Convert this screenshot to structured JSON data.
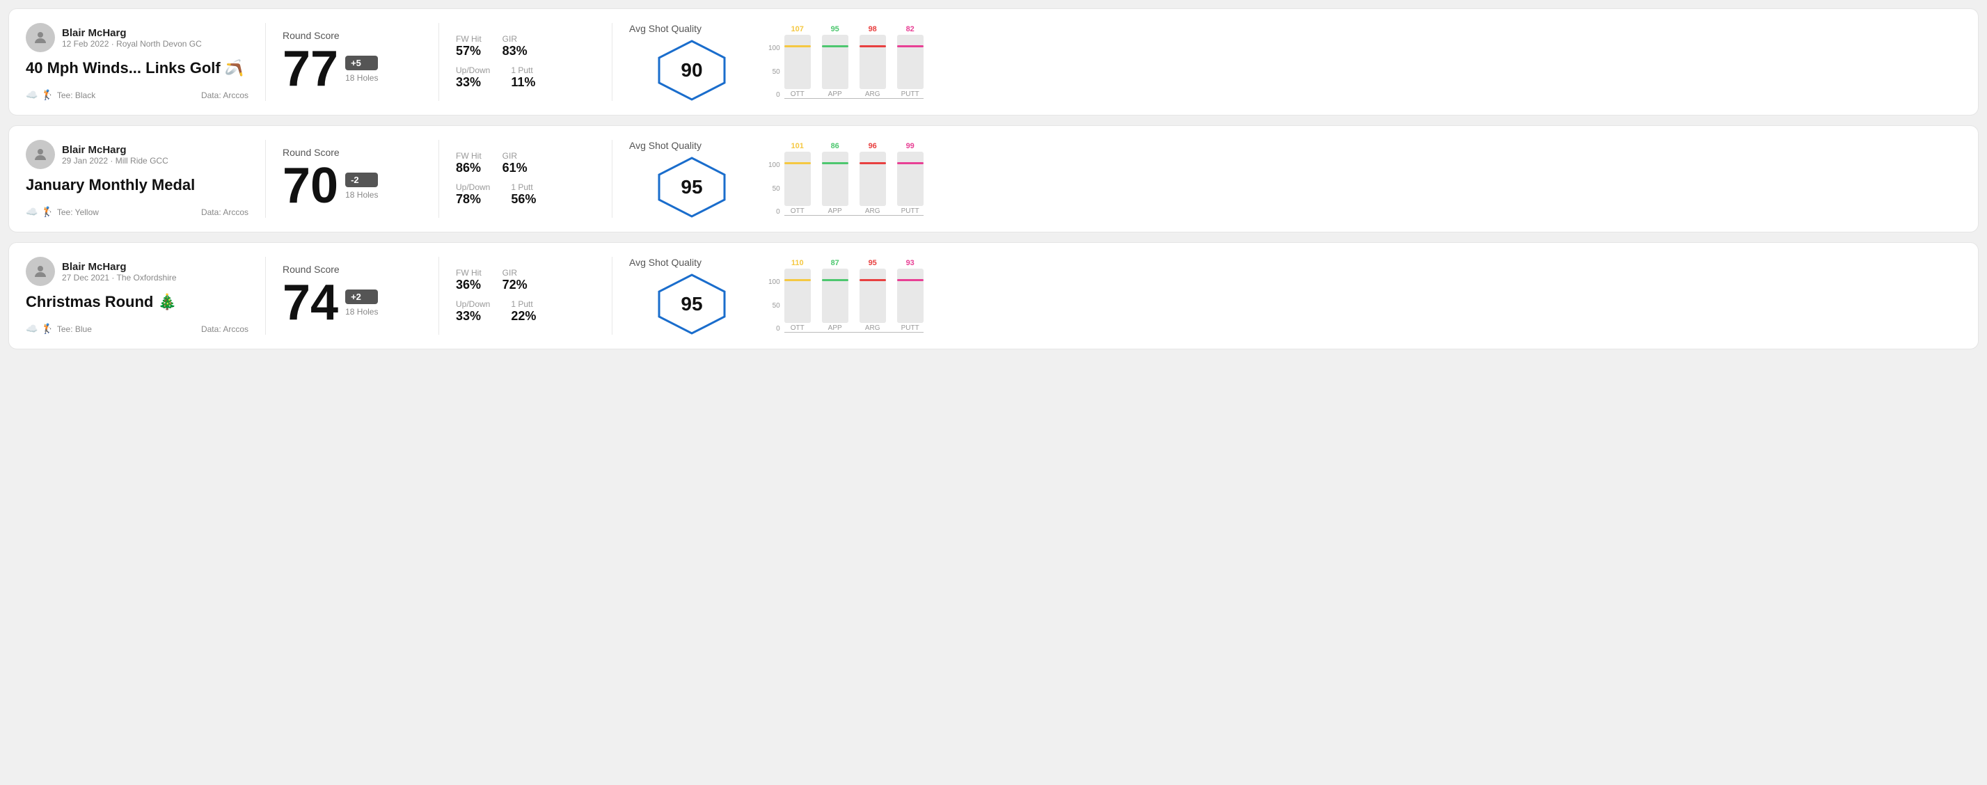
{
  "cards": [
    {
      "id": "card1",
      "user": {
        "name": "Blair McHarg",
        "sub": "12 Feb 2022 · Royal North Devon GC"
      },
      "title": "40 Mph Winds... Links Golf 🪃",
      "tee": "Black",
      "data_source": "Data: Arccos",
      "score": {
        "label": "Round Score",
        "value": "77",
        "badge": "+5",
        "holes": "18 Holes"
      },
      "stats": {
        "fw_hit_label": "FW Hit",
        "fw_hit_value": "57%",
        "gir_label": "GIR",
        "gir_value": "83%",
        "updown_label": "Up/Down",
        "updown_value": "33%",
        "oneputt_label": "1 Putt",
        "oneputt_value": "11%"
      },
      "quality": {
        "label": "Avg Shot Quality",
        "score": "90"
      },
      "chart": {
        "bars": [
          {
            "label": "OTT",
            "value": 107,
            "color": "#f5c842",
            "max": 150
          },
          {
            "label": "APP",
            "value": 95,
            "color": "#4dc76f",
            "max": 150
          },
          {
            "label": "ARG",
            "value": 98,
            "color": "#e84040",
            "max": 150
          },
          {
            "label": "PUTT",
            "value": 82,
            "color": "#e84095",
            "max": 150
          }
        ],
        "y_labels": [
          "100",
          "50",
          "0"
        ]
      }
    },
    {
      "id": "card2",
      "user": {
        "name": "Blair McHarg",
        "sub": "29 Jan 2022 · Mill Ride GCC"
      },
      "title": "January Monthly Medal",
      "tee": "Yellow",
      "data_source": "Data: Arccos",
      "score": {
        "label": "Round Score",
        "value": "70",
        "badge": "-2",
        "holes": "18 Holes"
      },
      "stats": {
        "fw_hit_label": "FW Hit",
        "fw_hit_value": "86%",
        "gir_label": "GIR",
        "gir_value": "61%",
        "updown_label": "Up/Down",
        "updown_value": "78%",
        "oneputt_label": "1 Putt",
        "oneputt_value": "56%"
      },
      "quality": {
        "label": "Avg Shot Quality",
        "score": "95"
      },
      "chart": {
        "bars": [
          {
            "label": "OTT",
            "value": 101,
            "color": "#f5c842",
            "max": 150
          },
          {
            "label": "APP",
            "value": 86,
            "color": "#4dc76f",
            "max": 150
          },
          {
            "label": "ARG",
            "value": 96,
            "color": "#e84040",
            "max": 150
          },
          {
            "label": "PUTT",
            "value": 99,
            "color": "#e84095",
            "max": 150
          }
        ],
        "y_labels": [
          "100",
          "50",
          "0"
        ]
      }
    },
    {
      "id": "card3",
      "user": {
        "name": "Blair McHarg",
        "sub": "27 Dec 2021 · The Oxfordshire"
      },
      "title": "Christmas Round 🎄",
      "tee": "Blue",
      "data_source": "Data: Arccos",
      "score": {
        "label": "Round Score",
        "value": "74",
        "badge": "+2",
        "holes": "18 Holes"
      },
      "stats": {
        "fw_hit_label": "FW Hit",
        "fw_hit_value": "36%",
        "gir_label": "GIR",
        "gir_value": "72%",
        "updown_label": "Up/Down",
        "updown_value": "33%",
        "oneputt_label": "1 Putt",
        "oneputt_value": "22%"
      },
      "quality": {
        "label": "Avg Shot Quality",
        "score": "95"
      },
      "chart": {
        "bars": [
          {
            "label": "OTT",
            "value": 110,
            "color": "#f5c842",
            "max": 150
          },
          {
            "label": "APP",
            "value": 87,
            "color": "#4dc76f",
            "max": 150
          },
          {
            "label": "ARG",
            "value": 95,
            "color": "#e84040",
            "max": 150
          },
          {
            "label": "PUTT",
            "value": 93,
            "color": "#e84095",
            "max": 150
          }
        ],
        "y_labels": [
          "100",
          "50",
          "0"
        ]
      }
    }
  ]
}
